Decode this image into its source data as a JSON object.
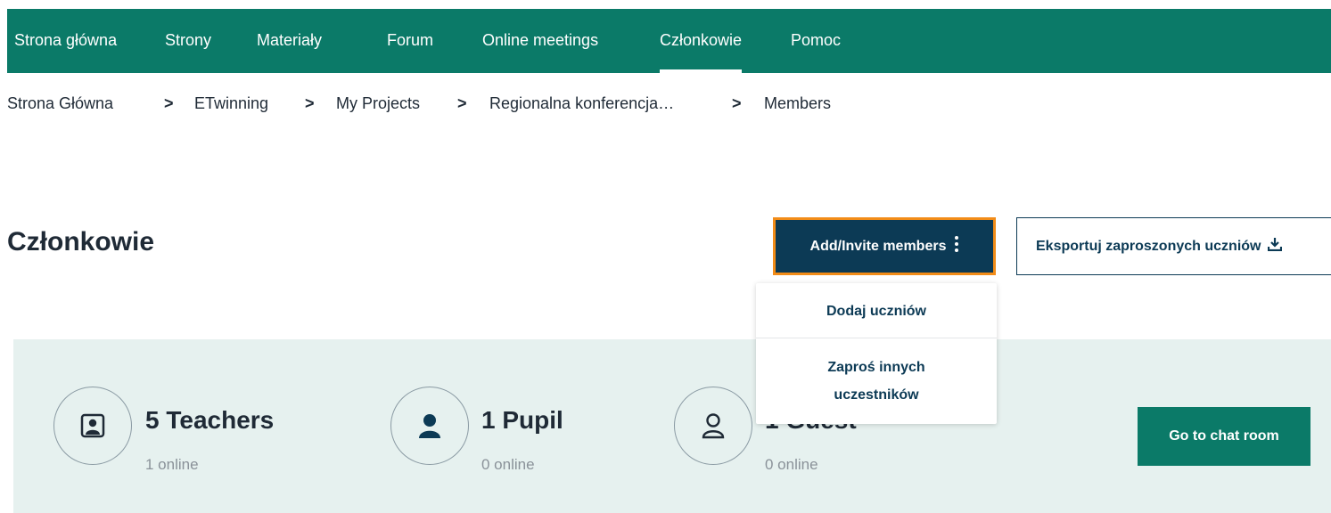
{
  "nav": {
    "items": [
      {
        "label": "Strona główna",
        "active": false
      },
      {
        "label": "Strony",
        "active": false
      },
      {
        "label": "Materiały",
        "active": false
      },
      {
        "label": "Forum",
        "active": false
      },
      {
        "label": "Online meetings",
        "active": false
      },
      {
        "label": "Członkowie",
        "active": true
      },
      {
        "label": "Pomoc",
        "active": false
      }
    ]
  },
  "breadcrumb": {
    "items": [
      "Strona Główna",
      "ETwinning",
      "My Projects",
      "Regionalna konferencja…",
      "Members"
    ],
    "separator": ">"
  },
  "page": {
    "title": "Członkowie",
    "add_invite_label": "Add/Invite members",
    "export_label": "Eksportuj zaproszonych uczniów"
  },
  "dropdown": {
    "items": [
      "Dodaj uczniów",
      "Zaproś innych uczestników"
    ],
    "item2_line1": "Zaproś innych",
    "item2_line2": "uczestników"
  },
  "stats": {
    "teachers": {
      "count": "5 Teachers",
      "online": "1 online",
      "icon": "teacher-icon"
    },
    "pupils": {
      "count": "1 Pupil",
      "online": "0 online",
      "icon": "pupil-icon"
    },
    "guests": {
      "count": "1 Guest",
      "online": "0 online",
      "icon": "guest-icon"
    }
  },
  "chat": {
    "label": "Go to chat room"
  },
  "colors": {
    "nav_bg": "#0b7a68",
    "primary_btn": "#0c3a55",
    "focus_border": "#f28c18",
    "panel_bg": "#e6f1ef",
    "chat_btn": "#0b7a68"
  }
}
